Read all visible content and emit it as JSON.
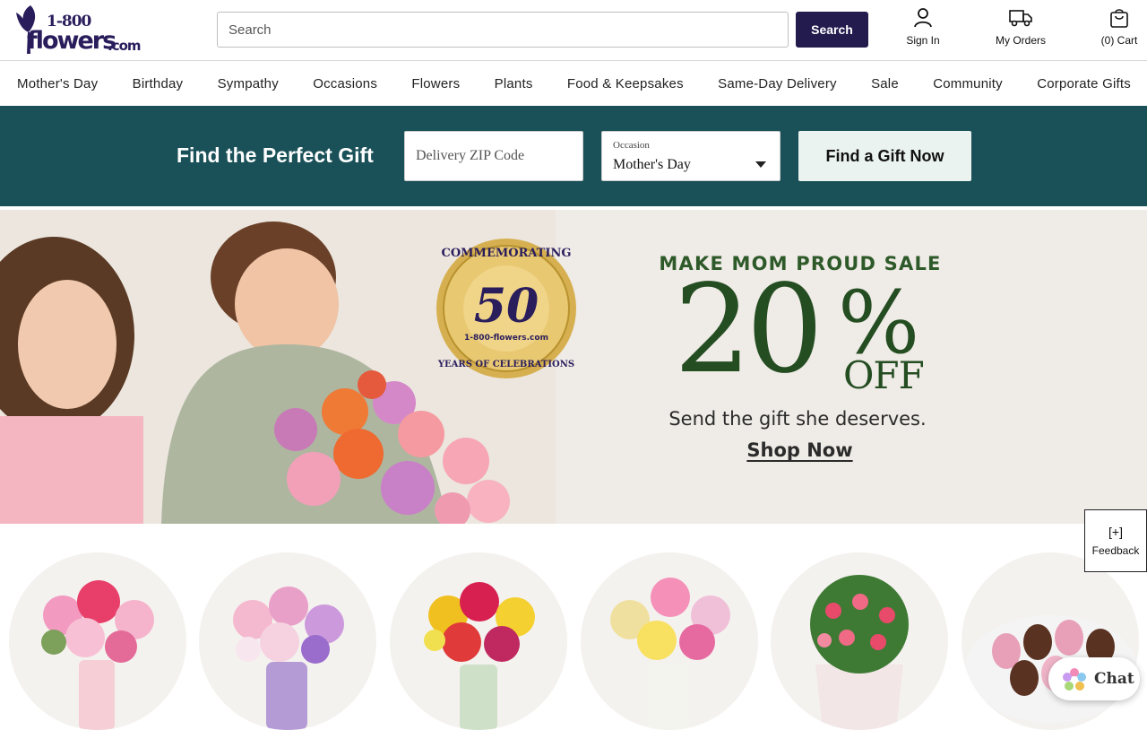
{
  "brand": {
    "logo_line1": "1-800",
    "logo_line2": "flowers",
    "logo_line3": ".com"
  },
  "header": {
    "search_placeholder": "Search",
    "search_button": "Search",
    "sign_in": "Sign In",
    "my_orders": "My Orders",
    "cart": "(0) Cart"
  },
  "nav": {
    "items": [
      "Mother's Day",
      "Birthday",
      "Sympathy",
      "Occasions",
      "Flowers",
      "Plants",
      "Food & Keepsakes",
      "Same-Day Delivery",
      "Sale",
      "Community",
      "Corporate Gifts"
    ]
  },
  "finder": {
    "title": "Find the Perfect Gift",
    "zip_placeholder": "Delivery ZIP Code",
    "occasion_label": "Occasion",
    "occasion_value": "Mother's Day",
    "button": "Find a Gift Now"
  },
  "hero": {
    "seal_top": "COMMEMORATING",
    "seal_number": "50",
    "seal_brand": "1-800-flowers.com",
    "seal_bottom": "YEARS OF CELEBRATIONS",
    "eyebrow": "MAKE MOM PROUD SALE",
    "discount_number": "20",
    "discount_percent": "%",
    "discount_off": "OFF",
    "subtitle": "Send the gift she deserves.",
    "cta": "Shop Now"
  },
  "widgets": {
    "feedback_icon": "[+]",
    "feedback_label": "Feedback",
    "chat_label": "Chat"
  },
  "colors": {
    "brand_navy": "#231a4e",
    "finder_teal": "#1a5058",
    "promo_green": "#244d22"
  }
}
